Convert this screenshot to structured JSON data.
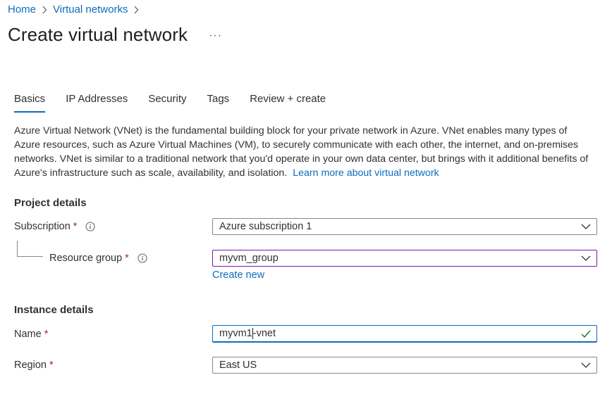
{
  "breadcrumb": {
    "items": [
      "Home",
      "Virtual networks"
    ]
  },
  "header": {
    "title": "Create virtual network",
    "more_label": "···"
  },
  "tabs": [
    {
      "label": "Basics",
      "active": true
    },
    {
      "label": "IP Addresses",
      "active": false
    },
    {
      "label": "Security",
      "active": false
    },
    {
      "label": "Tags",
      "active": false
    },
    {
      "label": "Review + create",
      "active": false
    }
  ],
  "description": {
    "text": "Azure Virtual Network (VNet) is the fundamental building block for your private network in Azure. VNet enables many types of Azure resources, such as Azure Virtual Machines (VM), to securely communicate with each other, the internet, and on-premises networks. VNet is similar to a traditional network that you'd operate in your own data center, but brings with it additional benefits of Azure's infrastructure such as scale, availability, and isolation.",
    "link": "Learn more about virtual network"
  },
  "project_details": {
    "heading": "Project details",
    "subscription": {
      "label": "Subscription",
      "required_mark": "*",
      "value": "Azure subscription 1"
    },
    "resource_group": {
      "label": "Resource group",
      "required_mark": "*",
      "value": "myvm_group",
      "create_new": "Create new"
    }
  },
  "instance_details": {
    "heading": "Instance details",
    "name": {
      "label": "Name",
      "required_mark": "*",
      "value_before_caret": "myvm1",
      "value_after_caret": "-vnet"
    },
    "region": {
      "label": "Region",
      "required_mark": "*",
      "value": "East US"
    }
  },
  "colors": {
    "link": "#0f6cbd",
    "required": "#a4262c",
    "focus_purple": "#7719aa",
    "valid_check": "#107c10"
  }
}
